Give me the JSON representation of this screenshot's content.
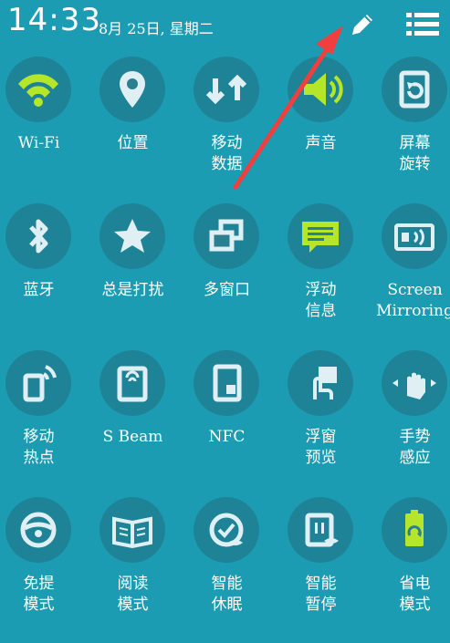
{
  "status_bar": {
    "time": "14:33",
    "date": "8月 25日, 星期二"
  },
  "colors": {
    "background": "#1c9cb2",
    "active_icon": "#b6e62a",
    "inactive_icon": "#dfeff3",
    "annotation_arrow": "#ef3f3f"
  },
  "tiles": [
    {
      "label": "Wi-Fi",
      "icon": "wifi-icon",
      "active": true
    },
    {
      "label": "位置",
      "icon": "location-pin-icon",
      "active": false
    },
    {
      "label": "移动\n数据",
      "icon": "mobile-data-arrows-icon",
      "active": false
    },
    {
      "label": "声音",
      "icon": "speaker-icon",
      "active": true
    },
    {
      "label": "屏幕\n旋转",
      "icon": "screen-rotation-icon",
      "active": false
    },
    {
      "label": "蓝牙",
      "icon": "bluetooth-icon",
      "active": false
    },
    {
      "label": "总是打扰",
      "icon": "star-icon",
      "active": false
    },
    {
      "label": "多窗口",
      "icon": "multi-window-icon",
      "active": false
    },
    {
      "label": "浮动\n信息",
      "icon": "chat-bubble-icon",
      "active": true
    },
    {
      "label": "Screen\nMirroring",
      "icon": "screen-mirroring-icon",
      "active": false
    },
    {
      "label": "移动\n热点",
      "icon": "hotspot-icon",
      "active": false
    },
    {
      "label": "S Beam",
      "icon": "s-beam-icon",
      "active": false
    },
    {
      "label": "NFC",
      "icon": "nfc-icon",
      "active": false
    },
    {
      "label": "浮窗\n预览",
      "icon": "air-view-icon",
      "active": false
    },
    {
      "label": "手势\n感应",
      "icon": "hand-gesture-icon",
      "active": false
    },
    {
      "label": "免提\n模式",
      "icon": "steering-wheel-icon",
      "active": false
    },
    {
      "label": "阅读\n模式",
      "icon": "book-icon",
      "active": false
    },
    {
      "label": "智能\n休眠",
      "icon": "smart-stay-icon",
      "active": false
    },
    {
      "label": "智能\n暂停",
      "icon": "smart-pause-icon",
      "active": false
    },
    {
      "label": "省电\n模式",
      "icon": "battery-recycle-icon",
      "active": true
    }
  ]
}
